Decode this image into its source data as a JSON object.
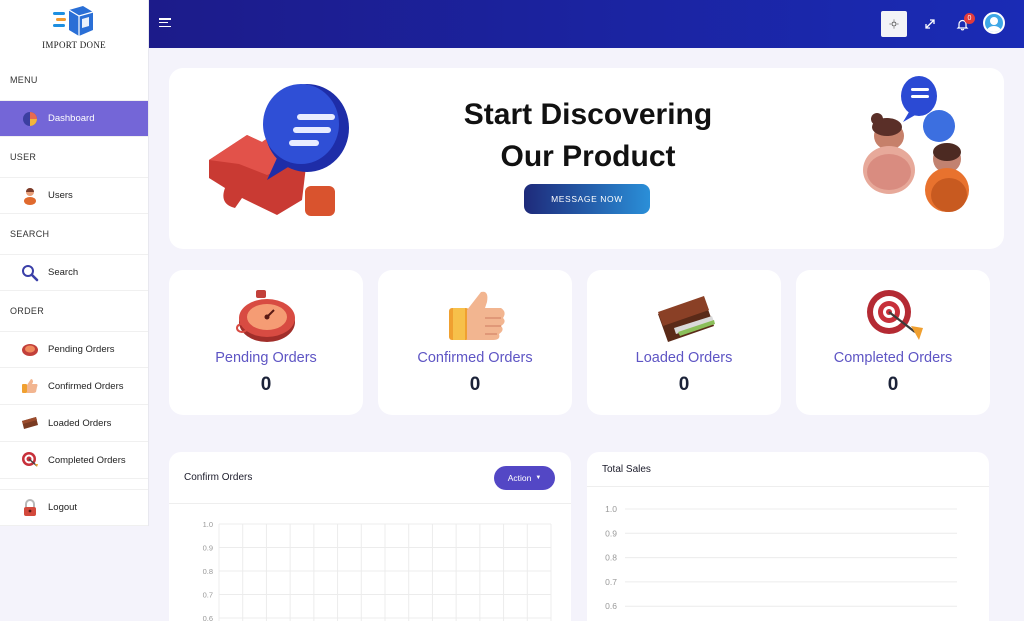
{
  "brand": {
    "name": "IMPORT DONE"
  },
  "sidebar": {
    "sections": [
      {
        "heading": "MENU"
      },
      {
        "heading": "USER"
      },
      {
        "heading": "SEARCH"
      },
      {
        "heading": "ORDER"
      }
    ],
    "items": [
      {
        "label": "Dashboard",
        "icon": "dashboard-icon",
        "active": true
      },
      {
        "label": "Users",
        "icon": "user-icon"
      },
      {
        "label": "Search",
        "icon": "search-icon"
      },
      {
        "label": "Pending Orders",
        "icon": "stopwatch-icon"
      },
      {
        "label": "Confirmed Orders",
        "icon": "thumbs-up-icon"
      },
      {
        "label": "Loaded Orders",
        "icon": "wallet-icon"
      },
      {
        "label": "Completed Orders",
        "icon": "target-icon"
      },
      {
        "label": "Logout",
        "icon": "lock-icon"
      }
    ]
  },
  "header": {
    "notification_count": "0",
    "icons": [
      "menu-icon",
      "sun-icon",
      "expand-icon",
      "bell-icon",
      "avatar"
    ]
  },
  "banner": {
    "title_line1": "Start Discovering",
    "title_line2": "Our Product",
    "button_label": "MESSAGE NOW"
  },
  "stats": [
    {
      "label": "Pending Orders",
      "value": "0",
      "icon": "stopwatch-icon"
    },
    {
      "label": "Confirmed Orders",
      "value": "0",
      "icon": "thumbs-up-icon"
    },
    {
      "label": "Loaded Orders",
      "value": "0",
      "icon": "wallet-icon"
    },
    {
      "label": "Completed Orders",
      "value": "0",
      "icon": "target-icon"
    }
  ],
  "panels": {
    "confirm_orders": {
      "title": "Confirm Orders",
      "action_label": "Action"
    },
    "total_sales": {
      "title": "Total Sales"
    }
  },
  "chart_data": [
    {
      "type": "line",
      "title": "Confirm Orders",
      "ylim": [
        0,
        1
      ],
      "ytick_labels": [
        "1.0",
        "0.9",
        "0.8",
        "0.7",
        "0.6"
      ],
      "ylabel": "",
      "grid": true,
      "series": []
    },
    {
      "type": "line",
      "title": "Total Sales",
      "ylim": [
        0,
        1
      ],
      "ytick_labels": [
        "1.0",
        "0.9",
        "0.8",
        "0.7",
        "0.6"
      ],
      "grid": true,
      "series": []
    }
  ],
  "colors": {
    "accent": "#7466d7",
    "header_start": "#1c1b8a",
    "header_end": "#1a2bb5",
    "stat_label": "#5e55c4",
    "action_button": "#5347c5"
  }
}
